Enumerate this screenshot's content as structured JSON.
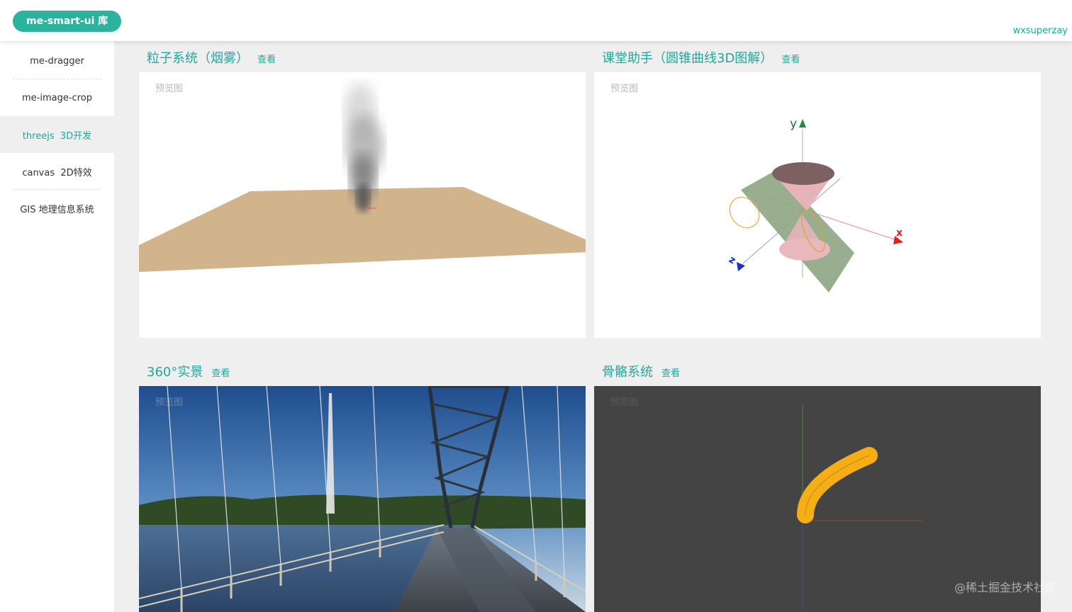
{
  "header": {
    "brand": "me-smart-ui 库",
    "user": "wxsuperzay"
  },
  "sidebar": {
    "items": [
      {
        "label": "me-dragger"
      },
      {
        "label": "me-image-crop"
      },
      {
        "label": "threejs  3D开发",
        "active": true
      },
      {
        "label": "canvas  2D特效"
      },
      {
        "label": "GIS 地理信息系统"
      }
    ]
  },
  "cards": [
    {
      "title": "粒子系统（烟雾）",
      "view": "查看",
      "preview": "预览图"
    },
    {
      "title": "课堂助手（圆锥曲线3D图解）",
      "view": "查看",
      "preview": "预览图"
    },
    {
      "title": "360°实景",
      "view": "查看",
      "preview": "预览图"
    },
    {
      "title": "骨骼系统",
      "view": "查看",
      "preview": "预览图"
    }
  ],
  "cone_axes": {
    "y": "y",
    "x": "x",
    "z": "z"
  },
  "watermark": "@稀土掘金技术社区",
  "colors": {
    "accent": "#2bb3a0",
    "link": "#26a69a",
    "sand": "#d2b48c",
    "bone": "#f6ae17"
  }
}
